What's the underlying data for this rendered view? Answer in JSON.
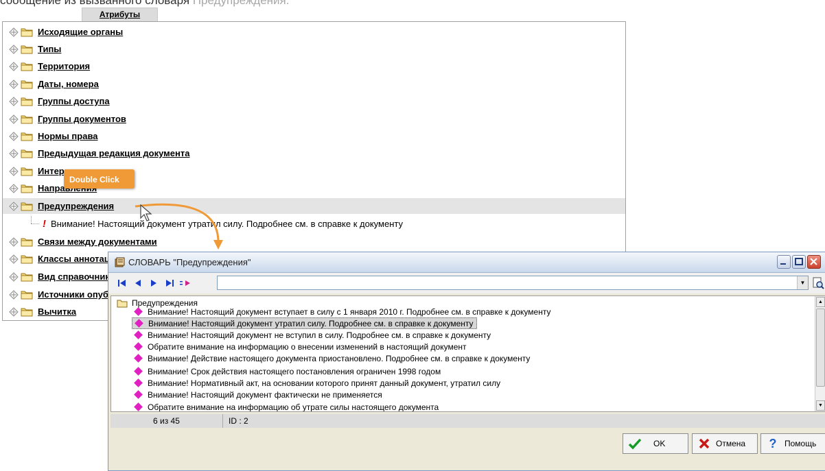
{
  "caption": {
    "text_prefix": "сообщение из вызванного словаря",
    "text_highlight": "Предупреждения."
  },
  "attributes_tab": {
    "label": "Атрибуты"
  },
  "tree": {
    "items": [
      {
        "label": "Исходящие органы"
      },
      {
        "label": "Типы"
      },
      {
        "label": "Территория"
      },
      {
        "label": "Даты, номера"
      },
      {
        "label": "Группы доступа"
      },
      {
        "label": "Группы документов"
      },
      {
        "label": "Нормы права"
      },
      {
        "label": "Предыдущая редакция документа"
      },
      {
        "label": "Интерпретация"
      },
      {
        "label": "Направления"
      },
      {
        "label": "Предупреждения"
      },
      {
        "label": "Связи между документами"
      },
      {
        "label": "Классы аннотаций"
      },
      {
        "label": "Вид справочника"
      },
      {
        "label": "Источники опубликования"
      },
      {
        "label": "Вычитка"
      }
    ],
    "selected_index": 10,
    "child_item": "Внимание! Настоящий документ утратил силу. Подробнее см. в справке к документу"
  },
  "callout": {
    "label": "Double Click"
  },
  "dialog": {
    "title": "СЛОВАРЬ \"Предупреждения\"",
    "search_value": "",
    "root_label": "Предупреждения",
    "items": [
      "Внимание! Настоящий документ вступает в силу с 1 января 2010 г. Подробнее см. в справке к документу",
      "Внимание! Настоящий документ утратил силу. Подробнее см. в справке к документу",
      "Внимание! Настоящий документ не вступил в силу. Подробнее см. в справке к документу",
      "Обратите внимание на информацию о внесении изменений в настоящий документ",
      "Внимание! Действие настоящего документа приостановлено. Подробнее см. в справке к документу",
      "Внимание! Срок действия настоящего постановления ограничен 1998 годом",
      "Внимание! Нормативный акт, на основании которого принят данный документ, утратил силу",
      "Внимание! Настоящий документ фактически не применяется",
      "Обратите внимание на информацию об утрате силы настоящего документа"
    ],
    "selected_index": 1,
    "status": {
      "position": "6 из 45",
      "id": "ID : 2"
    },
    "buttons": {
      "ok": "OK",
      "cancel": "Отмена",
      "help": "Помощь"
    }
  },
  "colors": {
    "accent_callout": "#ef9a37",
    "diamond": "#e020c0",
    "warning": "#d80000"
  }
}
